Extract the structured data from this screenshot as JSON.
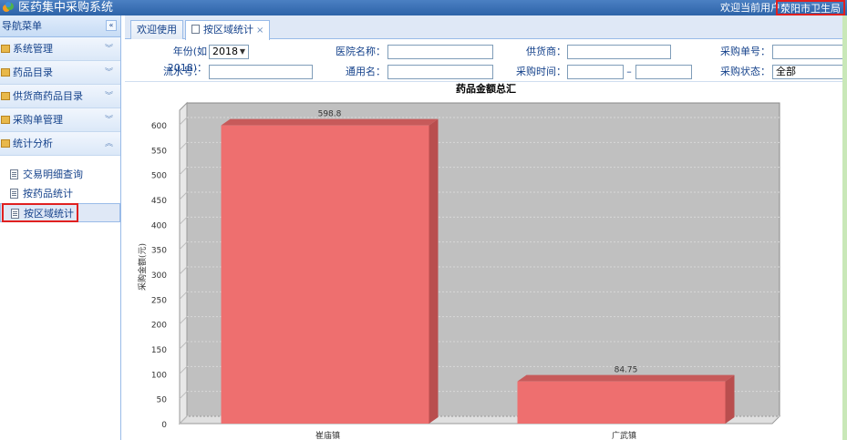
{
  "header": {
    "title": "医药集中采购系统",
    "welcome_label": "欢迎当前用户：",
    "user": "荥阳市卫生局"
  },
  "sidebar": {
    "title": "导航菜单",
    "collapse_glyph": "«",
    "sections": [
      {
        "label": "系统管理",
        "chevron": "︾"
      },
      {
        "label": "药品目录",
        "chevron": "︾"
      },
      {
        "label": "供货商药品目录",
        "chevron": "︾"
      },
      {
        "label": "采购单管理",
        "chevron": "︾"
      },
      {
        "label": "统计分析",
        "chevron": "︽"
      }
    ],
    "subitems": [
      {
        "label": "交易明细查询"
      },
      {
        "label": "按药品统计"
      },
      {
        "label": "按区域统计"
      }
    ]
  },
  "tabs": [
    {
      "label": "欢迎使用"
    },
    {
      "label": "按区域统计",
      "close": "×"
    }
  ],
  "form": {
    "year_label": "年份(如2018)：",
    "year_value": "2018",
    "hospital_label": "医院名称：",
    "hospital_value": "",
    "supplier_label": "供货商：",
    "supplier_value": "",
    "order_no_label": "采购单号：",
    "order_no_value": "",
    "serial_label": "流水号：",
    "serial_value": "",
    "generic_label": "通用名：",
    "generic_value": "",
    "time_label": "采购时间：",
    "time_from": "",
    "time_sep": "–",
    "time_to": "",
    "status_label": "采购状态：",
    "status_value": "全部"
  },
  "chart_data": {
    "type": "bar",
    "title": "药品金额总汇",
    "ylabel": "采购金额(元)",
    "xlabel": "",
    "categories": [
      "崔庙镇",
      "广武镇"
    ],
    "values": [
      598.8,
      84.75
    ],
    "value_labels": [
      "598.8",
      "84.75"
    ],
    "ylim": [
      0,
      600
    ],
    "yticks": [
      0,
      50,
      100,
      150,
      200,
      250,
      300,
      350,
      400,
      450,
      500,
      550,
      600
    ],
    "grid": true,
    "bar_color": "#ee6f6f",
    "plot_bg": "#c0c0c0"
  }
}
